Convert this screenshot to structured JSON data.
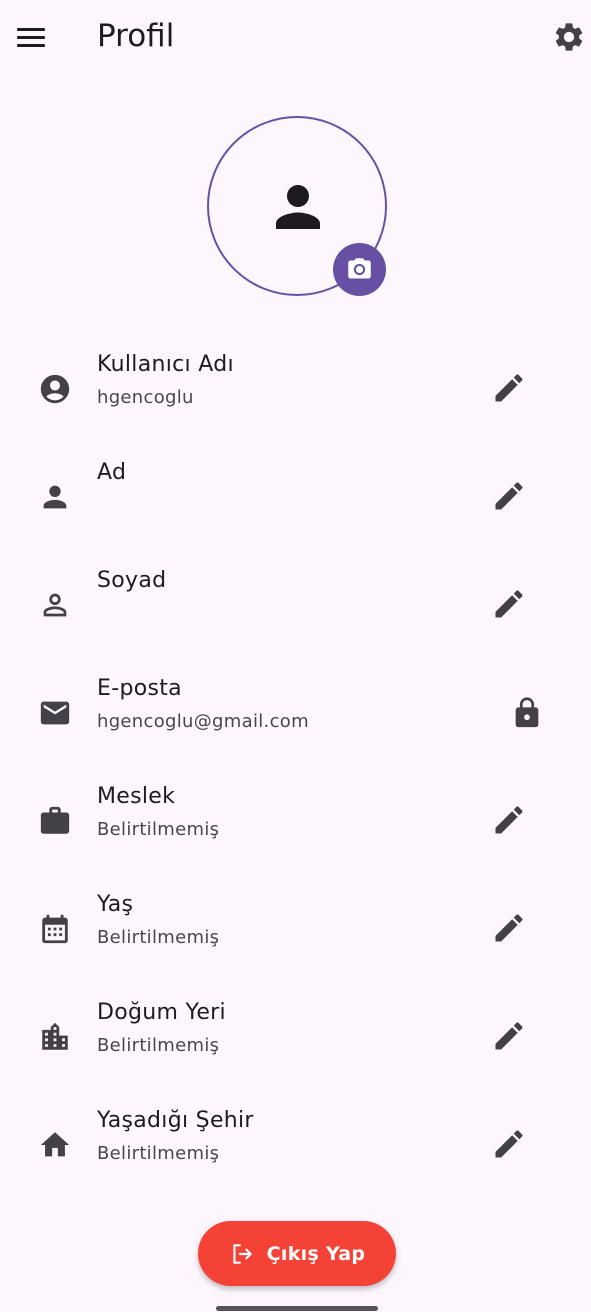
{
  "appbar": {
    "title": "Profil",
    "menu_icon": "hamburger-menu-icon",
    "settings_icon": "gear-icon"
  },
  "avatar": {
    "icon": "person-icon",
    "camera_icon": "camera-icon",
    "accent": "#6750a4"
  },
  "fields": [
    {
      "label": "Kullanıcı Adı",
      "value": "hgencoglu",
      "icon": "account-circle-icon",
      "action": "edit-icon"
    },
    {
      "label": "Ad",
      "value": "",
      "icon": "person-icon",
      "action": "edit-icon"
    },
    {
      "label": "Soyad",
      "value": "",
      "icon": "person-outline-icon",
      "action": "edit-icon"
    },
    {
      "label": "E-posta",
      "value": "hgencoglu@gmail.com",
      "icon": "mail-icon",
      "action": "lock-icon"
    },
    {
      "label": "Meslek",
      "value": "Belirtilmemiş",
      "icon": "briefcase-icon",
      "action": "edit-icon"
    },
    {
      "label": "Yaş",
      "value": "Belirtilmemiş",
      "icon": "calendar-icon",
      "action": "edit-icon"
    },
    {
      "label": "Doğum Yeri",
      "value": "Belirtilmemiş",
      "icon": "city-icon",
      "action": "edit-icon"
    },
    {
      "label": "Yaşadığı Şehir",
      "value": "Belirtilmemiş",
      "icon": "home-icon",
      "action": "edit-icon"
    }
  ],
  "logout": {
    "label": "Çıkış Yap",
    "icon": "logout-icon",
    "color": "#f44336"
  }
}
